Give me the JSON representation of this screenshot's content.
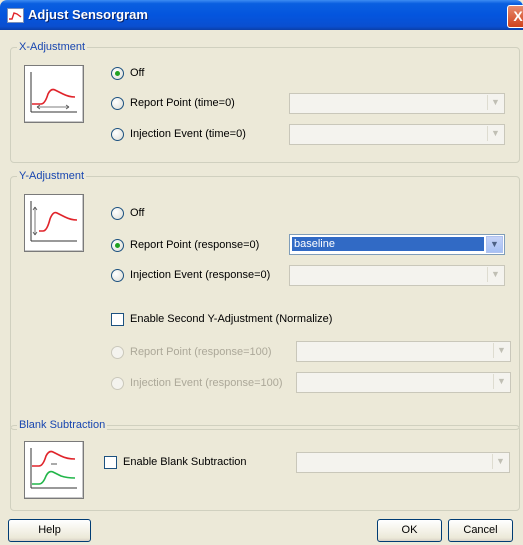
{
  "window": {
    "title": "Adjust Sensorgram",
    "close_label": "X"
  },
  "x_adjustment": {
    "legend": "X-Adjustment",
    "options": [
      {
        "label": "Off",
        "selected": true
      },
      {
        "label": "Report Point (time=0)",
        "selected": false
      },
      {
        "label": "Injection Event (time=0)",
        "selected": false
      }
    ]
  },
  "y_adjustment": {
    "legend": "Y-Adjustment",
    "options": [
      {
        "label": "Off",
        "selected": false
      },
      {
        "label": "Report Point  (response=0)",
        "selected": true,
        "combo_value": "baseline"
      },
      {
        "label": "Injection Event  (response=0)",
        "selected": false
      }
    ],
    "second_adjustment_label": "Enable Second Y-Adjustment (Normalize)",
    "second_options": [
      {
        "label": "Report Point  (response=100)"
      },
      {
        "label": "Injection Event  (response=100)"
      }
    ]
  },
  "blank_subtraction": {
    "legend": "Blank Subtraction",
    "checkbox_label": "Enable Blank Subtraction"
  },
  "buttons": {
    "help": "Help",
    "ok": "OK",
    "cancel": "Cancel"
  },
  "colors": {
    "curve_red": "#e0242b",
    "curve_green": "#22b64a",
    "legend_blue": "#1846b0"
  }
}
